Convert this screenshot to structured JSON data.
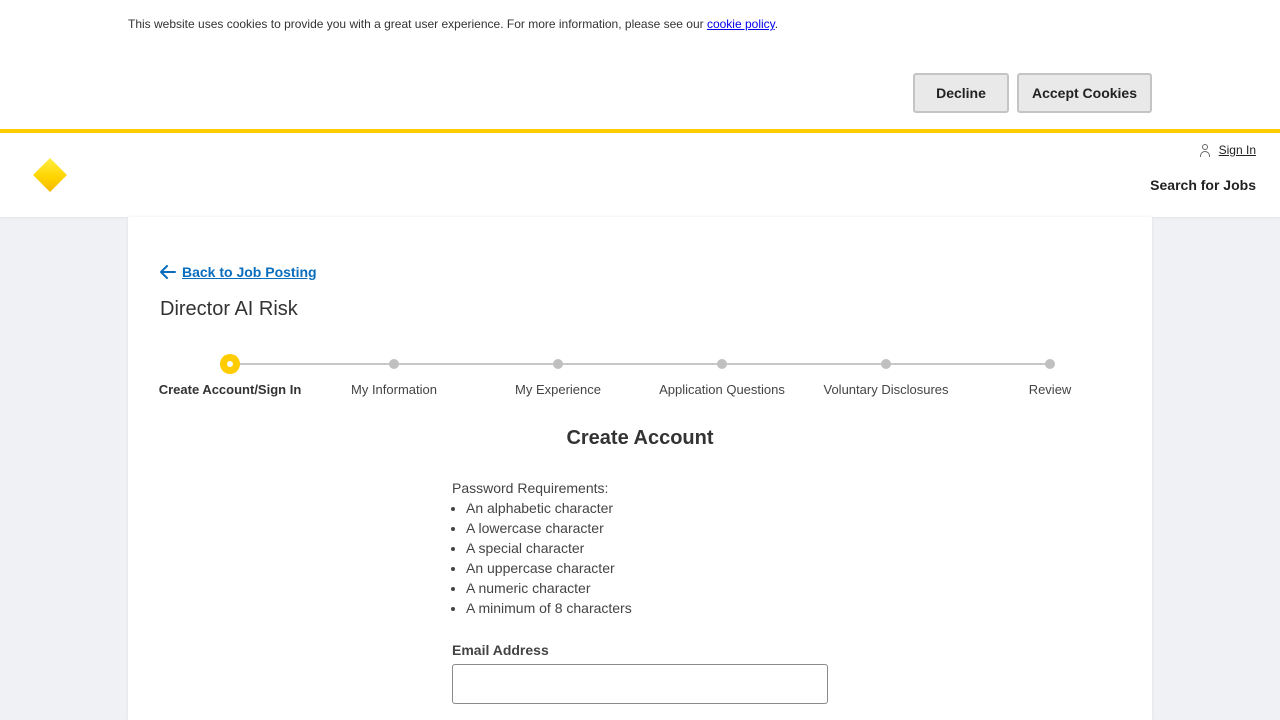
{
  "cookie_banner": {
    "text": "This website uses cookies to provide you with a great user experience. For more information, please see our ",
    "link_text": "cookie policy",
    "text_end": ".",
    "decline_label": "Decline",
    "accept_label": "Accept Cookies"
  },
  "header": {
    "sign_in_label": "Sign In",
    "search_jobs_label": "Search for Jobs"
  },
  "page": {
    "back_label": "Back to Job Posting",
    "job_title": "Director AI Risk"
  },
  "stepper": {
    "steps": [
      {
        "label": "Create Account/Sign In",
        "active": true
      },
      {
        "label": "My Information",
        "active": false
      },
      {
        "label": "My Experience",
        "active": false
      },
      {
        "label": "Application Questions",
        "active": false
      },
      {
        "label": "Voluntary Disclosures",
        "active": false
      },
      {
        "label": "Review",
        "active": false
      }
    ]
  },
  "form": {
    "title": "Create Account",
    "pw_heading": "Password Requirements:",
    "pw_rules": [
      "An alphabetic character",
      "A lowercase character",
      "A special character",
      "An uppercase character",
      "A numeric character",
      "A minimum of 8 characters"
    ],
    "email_label": "Email Address",
    "email_value": ""
  },
  "colors": {
    "brand_yellow": "#ffcc00",
    "link_blue": "#0a6ebd"
  }
}
